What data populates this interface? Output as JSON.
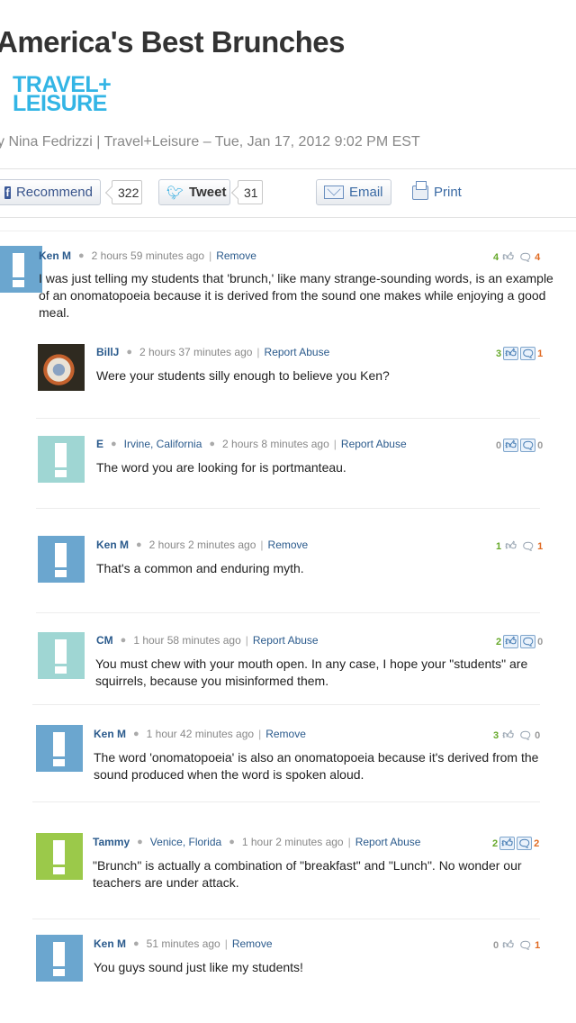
{
  "article": {
    "title": "America's Best Brunches",
    "brand_line1": "TRAVEL+",
    "brand_line2": "LEISURE",
    "byline": "y Nina Fedrizzi | Travel+Leisure – Tue, Jan 17, 2012 9:02 PM EST"
  },
  "share": {
    "recommend_label": "Recommend",
    "recommend_count": "322",
    "tweet_label": "Tweet",
    "tweet_count": "31",
    "email_label": "Email",
    "print_label": "Print"
  },
  "colors": {
    "brand": "#33b5e5",
    "link": "#2a5a8c",
    "upvote": "#66a82a",
    "downvote": "#e06a22"
  },
  "comments": [
    {
      "author": "Ken M",
      "location": "",
      "time": "2 hours 59 minutes ago",
      "action": "Remove",
      "text": "I was just telling my students that 'brunch,' like many strange-sounding words, is an example of an onomatopoeia because it is derived from the sound one makes while enjoying a good meal.",
      "up": "4",
      "down": "4",
      "avatar": "blue-exclamation-icon"
    },
    {
      "author": "BillJ",
      "location": "",
      "time": "2 hours 37 minutes ago",
      "action": "Report Abuse",
      "text": "Were your students silly enough to believe you Ken?",
      "up": "3",
      "down": "1",
      "avatar": "user-photo"
    },
    {
      "author": "E",
      "location": "Irvine, California",
      "time": "2 hours 8 minutes ago",
      "action": "Report Abuse",
      "text": "The word you are looking for is portmanteau.",
      "up": "0",
      "down": "0",
      "avatar": "teal-exclamation-icon"
    },
    {
      "author": "Ken M",
      "location": "",
      "time": "2 hours 2 minutes ago",
      "action": "Remove",
      "text": "That's a common and enduring myth.",
      "up": "1",
      "down": "1",
      "avatar": "blue-exclamation-icon"
    },
    {
      "author": "CM",
      "location": "",
      "time": "1 hour 58 minutes ago",
      "action": "Report Abuse",
      "text": "You must chew with your mouth open. In any case, I hope your \"students\" are squirrels, because you misinformed them.",
      "up": "2",
      "down": "0",
      "avatar": "teal-exclamation-icon"
    },
    {
      "author": "Ken M",
      "location": "",
      "time": "1 hour 42 minutes ago",
      "action": "Remove",
      "text": "The word 'onomatopoeia' is also an onomatopoeia because it's derived from the sound produced when the word is spoken aloud.",
      "up": "3",
      "down": "0",
      "avatar": "blue-exclamation-icon"
    },
    {
      "author": "Tammy",
      "location": "Venice, Florida",
      "time": "1 hour 2 minutes ago",
      "action": "Report Abuse",
      "text": "\"Brunch\" is actually a combination of \"breakfast\" and \"Lunch\". No wonder our teachers are under attack.",
      "up": "2",
      "down": "2",
      "avatar": "green-exclamation-icon"
    },
    {
      "author": "Ken M",
      "location": "",
      "time": "51 minutes ago",
      "action": "Remove",
      "text": "You guys sound just like my students!",
      "up": "0",
      "down": "1",
      "avatar": "blue-exclamation-icon"
    }
  ]
}
